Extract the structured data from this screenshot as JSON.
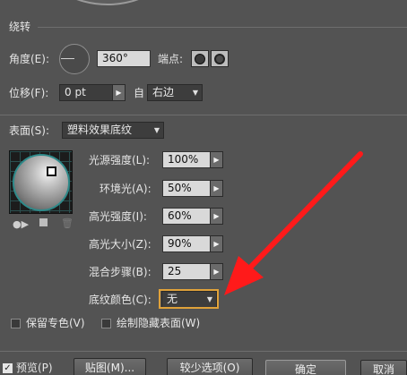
{
  "rotation": {
    "section_title": "绕转",
    "angle_label": "角度(E):",
    "angle_value": "360°",
    "endpoint_label": "端点:",
    "offset_label": "位移(F):",
    "offset_value": "0 pt",
    "from_label": "自",
    "from_value": "右边"
  },
  "surface": {
    "label": "表面(S):",
    "value": "塑料效果底纹"
  },
  "lighting": {
    "light_intensity_label": "光源强度(L):",
    "light_intensity_value": "100%",
    "ambient_label": "环境光(A):",
    "ambient_value": "50%",
    "highlight_intensity_label": "高光强度(I):",
    "highlight_intensity_value": "60%",
    "highlight_size_label": "高光大小(Z):",
    "highlight_size_value": "90%",
    "blend_steps_label": "混合步骤(B):",
    "blend_steps_value": "25",
    "shading_color_label": "底纹颜色(C):",
    "shading_color_value": "无"
  },
  "options": {
    "preserve_spot_label": "保留专色(V)",
    "draw_hidden_label": "绘制隐藏表面(W)"
  },
  "footer": {
    "preview_label": "预览(P)",
    "map_button": "贴图(M)...",
    "fewer_options_button": "较少选项(O)",
    "ok_button": "确定",
    "cancel_button": "取消"
  },
  "annotation": {
    "arrow_color": "#ff1a1a",
    "highlight_color": "#e0a23a"
  }
}
